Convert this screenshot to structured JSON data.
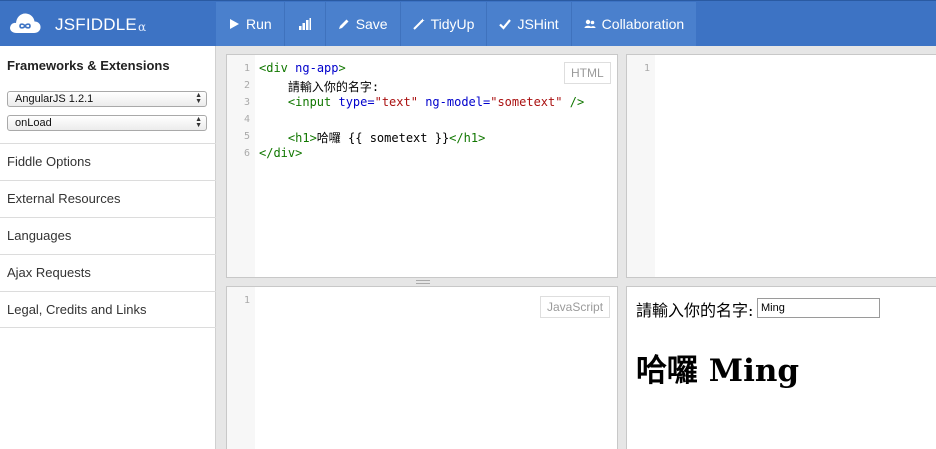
{
  "header": {
    "logo_text": "JSFIDDLE",
    "version_glyph": "α",
    "toolbar": [
      {
        "label": "Run",
        "icon": "play-icon"
      },
      {
        "label": "",
        "icon": "signal-bars-icon"
      },
      {
        "label": "Save",
        "icon": "pencil-icon"
      },
      {
        "label": "TidyUp",
        "icon": "wand-icon"
      },
      {
        "label": "JSHint",
        "icon": "check-icon"
      },
      {
        "label": "Collaboration",
        "icon": "users-icon"
      }
    ]
  },
  "sidebar": {
    "frameworks_title": "Frameworks & Extensions",
    "library_select": "AngularJS 1.2.1",
    "load_select": "onLoad",
    "items": [
      {
        "label": "Fiddle Options"
      },
      {
        "label": "External Resources"
      },
      {
        "label": "Languages"
      },
      {
        "label": "Ajax Requests"
      },
      {
        "label": "Legal, Credits and Links"
      }
    ]
  },
  "html_panel": {
    "label": "HTML",
    "line_numbers": [
      "1",
      "2",
      "3",
      "4",
      "5",
      "6"
    ],
    "lines": {
      "l1_open": "<div",
      "l1_attr": "ng-app",
      "l1_close": ">",
      "l2_text": "    請輸入你的名字:",
      "l3_open": "    <input",
      "l3_attr1": "type=",
      "l3_val1": "\"text\"",
      "l3_attr2": "ng-model=",
      "l3_val2": "\"sometext\"",
      "l3_close": "/>",
      "l5_open": "    <h1>",
      "l5_text": "哈囉 {{ sometext }}",
      "l5_close": "</h1>",
      "l6": "</div>"
    }
  },
  "css_panel": {
    "line_numbers": [
      "1"
    ]
  },
  "js_panel": {
    "label": "JavaScript",
    "line_numbers": [
      "1"
    ]
  },
  "result": {
    "prompt": "請輸入你的名字:",
    "input_value": "Ming",
    "greeting": "哈囉 Ming"
  },
  "colors": {
    "header_bg": "#3d73c4",
    "toolbar_bg": "#4a80cd"
  }
}
